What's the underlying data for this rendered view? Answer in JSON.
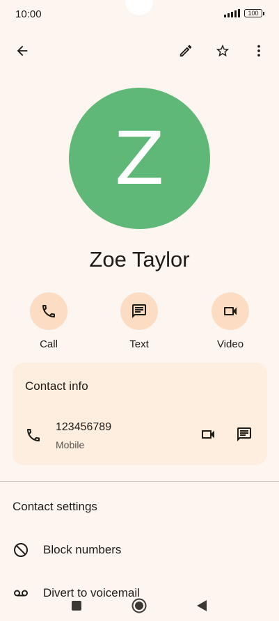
{
  "status_bar": {
    "time": "10:00",
    "battery": "100"
  },
  "toolbar": {
    "back_icon": "arrow-left-icon",
    "edit_icon": "pencil-icon",
    "favorite_icon": "star-outline-icon",
    "more_icon": "more-vert-icon"
  },
  "contact": {
    "initial": "Z",
    "name": "Zoe Taylor",
    "avatar_color": "#5fb877"
  },
  "actions": [
    {
      "label": "Call",
      "icon": "phone-icon"
    },
    {
      "label": "Text",
      "icon": "message-icon"
    },
    {
      "label": "Video",
      "icon": "video-icon"
    }
  ],
  "contact_info": {
    "title": "Contact info",
    "phone": {
      "number": "123456789",
      "type": "Mobile"
    }
  },
  "contact_settings": {
    "title": "Contact settings",
    "items": [
      {
        "label": "Block numbers",
        "icon": "block-icon"
      },
      {
        "label": "Divert to voicemail",
        "icon": "voicemail-icon"
      }
    ]
  },
  "colors": {
    "background": "#fdf6f0",
    "action_circle": "#fcdcc2",
    "card": "#fdeee0"
  }
}
